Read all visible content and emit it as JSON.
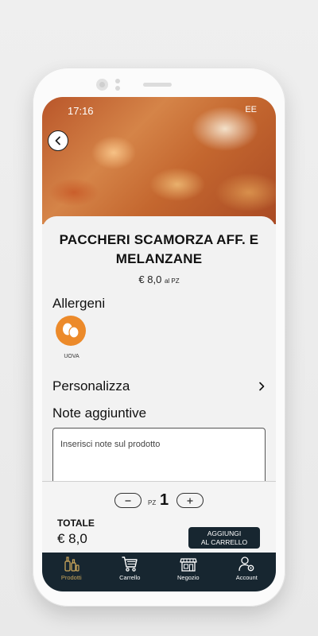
{
  "status_bar": {
    "time": "17:16",
    "right": "EE"
  },
  "product": {
    "name": "PACCHERI SCAMORZA AFF.  E MELANZANE",
    "price": "€ 8,0",
    "price_unit": "al PZ"
  },
  "allergens": {
    "title": "Allergeni",
    "items": [
      {
        "label": "UOVA",
        "icon": "eggs-icon"
      }
    ]
  },
  "personalize": {
    "label": "Personalizza"
  },
  "notes": {
    "title": "Note aggiuntive",
    "placeholder": "Inserisci note sul prodotto",
    "value": ""
  },
  "quantity": {
    "unit": "PZ",
    "value": "1"
  },
  "total": {
    "label": "TOTALE",
    "value": "€ 8,0"
  },
  "add_button": {
    "line1": "AGGIUNGI",
    "line2": "AL CARRELLO"
  },
  "nav": {
    "items": [
      {
        "label": "Prodotti",
        "icon": "bottles-icon",
        "active": true
      },
      {
        "label": "Carrello",
        "icon": "cart-icon",
        "active": false
      },
      {
        "label": "Negozio",
        "icon": "store-icon",
        "active": false
      },
      {
        "label": "Account",
        "icon": "account-icon",
        "active": false
      }
    ]
  },
  "colors": {
    "accent": "#ec8a2a",
    "nav_background": "#172630",
    "nav_active": "#c9a55a",
    "button": "#172630"
  }
}
